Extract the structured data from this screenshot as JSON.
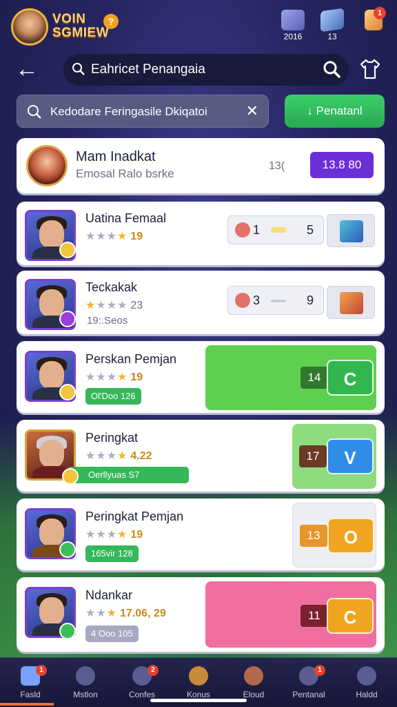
{
  "header": {
    "brand": "VOIN\nSGMIEW",
    "brand_badge": "?",
    "resources": [
      {
        "icon": "gem-chest-icon",
        "value": "2016"
      },
      {
        "icon": "crate-icon",
        "value": "13"
      },
      {
        "icon": "gift-icon",
        "value": "",
        "badge": "1"
      }
    ],
    "title": "Eahricet Penangaia",
    "search_placeholder": "Kedodare Feringasile Dkiqatoi",
    "download_label": "↓ Penatanl"
  },
  "hero": {
    "name": "Mam Inadkat",
    "subtitle": "Emosal Ralo bsrke",
    "middle_value": "13(",
    "button_label": "13.8 80"
  },
  "players": [
    {
      "name": "Uatina Femaal",
      "stars_filled": 1,
      "rating": "19",
      "stat_a": "1",
      "stat_b": "5"
    },
    {
      "name": "Teckakak",
      "stars_filled": 1,
      "rating": "23",
      "sub": "19:.Seos",
      "stat_a": "3",
      "stat_b": "9"
    },
    {
      "name": "Perskan Pemjan",
      "stars_filled": 1,
      "rating": "19",
      "pill": "Ol'Doo 126",
      "count": "14",
      "action": "C",
      "panel_color": "#5fcf4f",
      "button_color": "#32b74f"
    },
    {
      "name": "Peringkat",
      "stars_filled": 1,
      "rating": "4.22",
      "pill": "Oerllyuas S7",
      "count": "17",
      "action": "V",
      "panel_color": "#8fdc7f",
      "button_color": "#2f8de8"
    },
    {
      "name": "Peringkat Pemjan",
      "stars_filled": 1,
      "rating": "19",
      "pill": "165vir 128",
      "count": "13",
      "action": "O",
      "panel_color": "#eceef4",
      "button_color": "#f0a420"
    },
    {
      "name": "Ndankar",
      "stars_filled": 1,
      "rating": "17.06, 29",
      "pill": "4 Ooo 105",
      "count": "11",
      "action": "C",
      "panel_color": "#f06fa0",
      "button_color": "#f0a420"
    }
  ],
  "nav": [
    {
      "label": "Fasld",
      "badge": "1",
      "icon": "home-icon"
    },
    {
      "label": "Mstlon",
      "badge": "",
      "icon": "chat-icon"
    },
    {
      "label": "Confes",
      "badge": "2",
      "icon": "controller-icon"
    },
    {
      "label": "Konus",
      "badge": "",
      "icon": "hammer-icon"
    },
    {
      "label": "Eloud",
      "badge": "",
      "icon": "shield-icon"
    },
    {
      "label": "Pentanal",
      "badge": "1",
      "icon": "mail-icon"
    },
    {
      "label": "Haldd",
      "badge": "",
      "icon": "search-icon"
    }
  ]
}
